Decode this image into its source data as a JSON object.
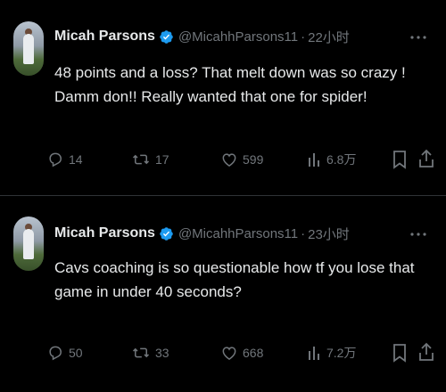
{
  "tweets": [
    {
      "author_name": "Micah Parsons",
      "handle": "@MicahhParsons11",
      "separator": "·",
      "time": "22小时",
      "text": "48 points and a loss? That melt down was so crazy ! Damm don!! Really wanted that one for spider!",
      "replies": "14",
      "reposts": "17",
      "likes": "599",
      "views": "6.8万"
    },
    {
      "author_name": "Micah Parsons",
      "handle": "@MicahhParsons11",
      "separator": "·",
      "time": "23小时",
      "text": "Cavs coaching is so questionable how tf you lose that game in under 40 seconds?",
      "replies": "50",
      "reposts": "33",
      "likes": "668",
      "views": "7.2万"
    }
  ],
  "icons": {
    "verified": "verified-badge-icon",
    "more": "more-horizontal-icon",
    "reply": "reply-icon",
    "repost": "repost-icon",
    "like": "heart-icon",
    "views": "views-chart-icon",
    "bookmark": "bookmark-icon",
    "share": "share-icon"
  },
  "colors": {
    "background": "#000000",
    "text_primary": "#e7e9ea",
    "text_secondary": "#71767b",
    "verified_blue": "#1d9bf0",
    "divider": "#2f3336"
  }
}
